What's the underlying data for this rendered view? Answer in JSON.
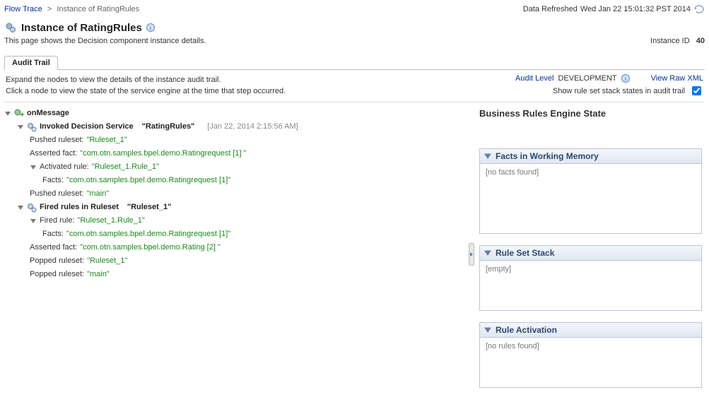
{
  "breadcrumb": {
    "root": "Flow Trace",
    "sep": ">",
    "current": "Instance of RatingRules"
  },
  "refreshed": {
    "prefix": "Data Refreshed",
    "time": "Wed Jan 22 15:01:32 PST 2014"
  },
  "page_title": "Instance of RatingRules",
  "page_subtitle": "This page shows the Decision component instance details.",
  "instance_id_label": "Instance ID",
  "instance_id_value": "40",
  "tab_label": "Audit Trail",
  "info_lines": {
    "l1": "Expand the nodes to view the details of the instance audit trail.",
    "l2": "Click a node to view the state of the service engine at the time that step occurred."
  },
  "audit_level": {
    "label": "Audit Level",
    "value": "DEVELOPMENT"
  },
  "xml_link": "View Raw XML",
  "stack_toggle_label": "Show rule set stack states in audit trail",
  "tree": {
    "root": {
      "label": "onMessage"
    },
    "invoked": {
      "label_prefix": "Invoked Decision Service",
      "label_value": "\"RatingRules\"",
      "timestamp": "[Jan 22, 2014 2:15:56 AM]",
      "pushed1": {
        "k": "Pushed ruleset:",
        "v": "\"Ruleset_1\""
      },
      "asserted": {
        "k": "Asserted fact:",
        "v": "\"com.otn.samples.bpel.demo.Ratingrequest [1] \""
      },
      "activated": {
        "k": "Activated rule:",
        "v": "\"Ruleset_1.Rule_1\"",
        "facts": {
          "k": "Facts:",
          "v": "\"com.otn.samples.bpel.demo.Ratingrequest [1]\""
        }
      },
      "pushed2": {
        "k": "Pushed ruleset:",
        "v": "\"main\""
      }
    },
    "fired": {
      "label_prefix": "Fired rules in Ruleset",
      "label_value": "\"Ruleset_1\"",
      "rule": {
        "k": "Fired rule:",
        "v": "\"Ruleset_1.Rule_1\"",
        "facts": {
          "k": "Facts:",
          "v": "\"com.otn.samples.bpel.demo.Ratingrequest [1]\""
        }
      },
      "asserted": {
        "k": "Asserted fact:",
        "v": "\"com.otn.samples.bpel.demo.Rating [2] \""
      },
      "popped1": {
        "k": "Popped ruleset:",
        "v": "\"Ruleset_1\""
      },
      "popped2": {
        "k": "Popped ruleset:",
        "v": "\"main\""
      }
    }
  },
  "right": {
    "title": "Business Rules Engine State",
    "facts_panel": {
      "header": "Facts in Working Memory",
      "body": "[no facts found]"
    },
    "stack_panel": {
      "header": "Rule Set Stack",
      "body": "[empty]"
    },
    "activation_panel": {
      "header": "Rule Activation",
      "body": "[no rules found]"
    }
  }
}
